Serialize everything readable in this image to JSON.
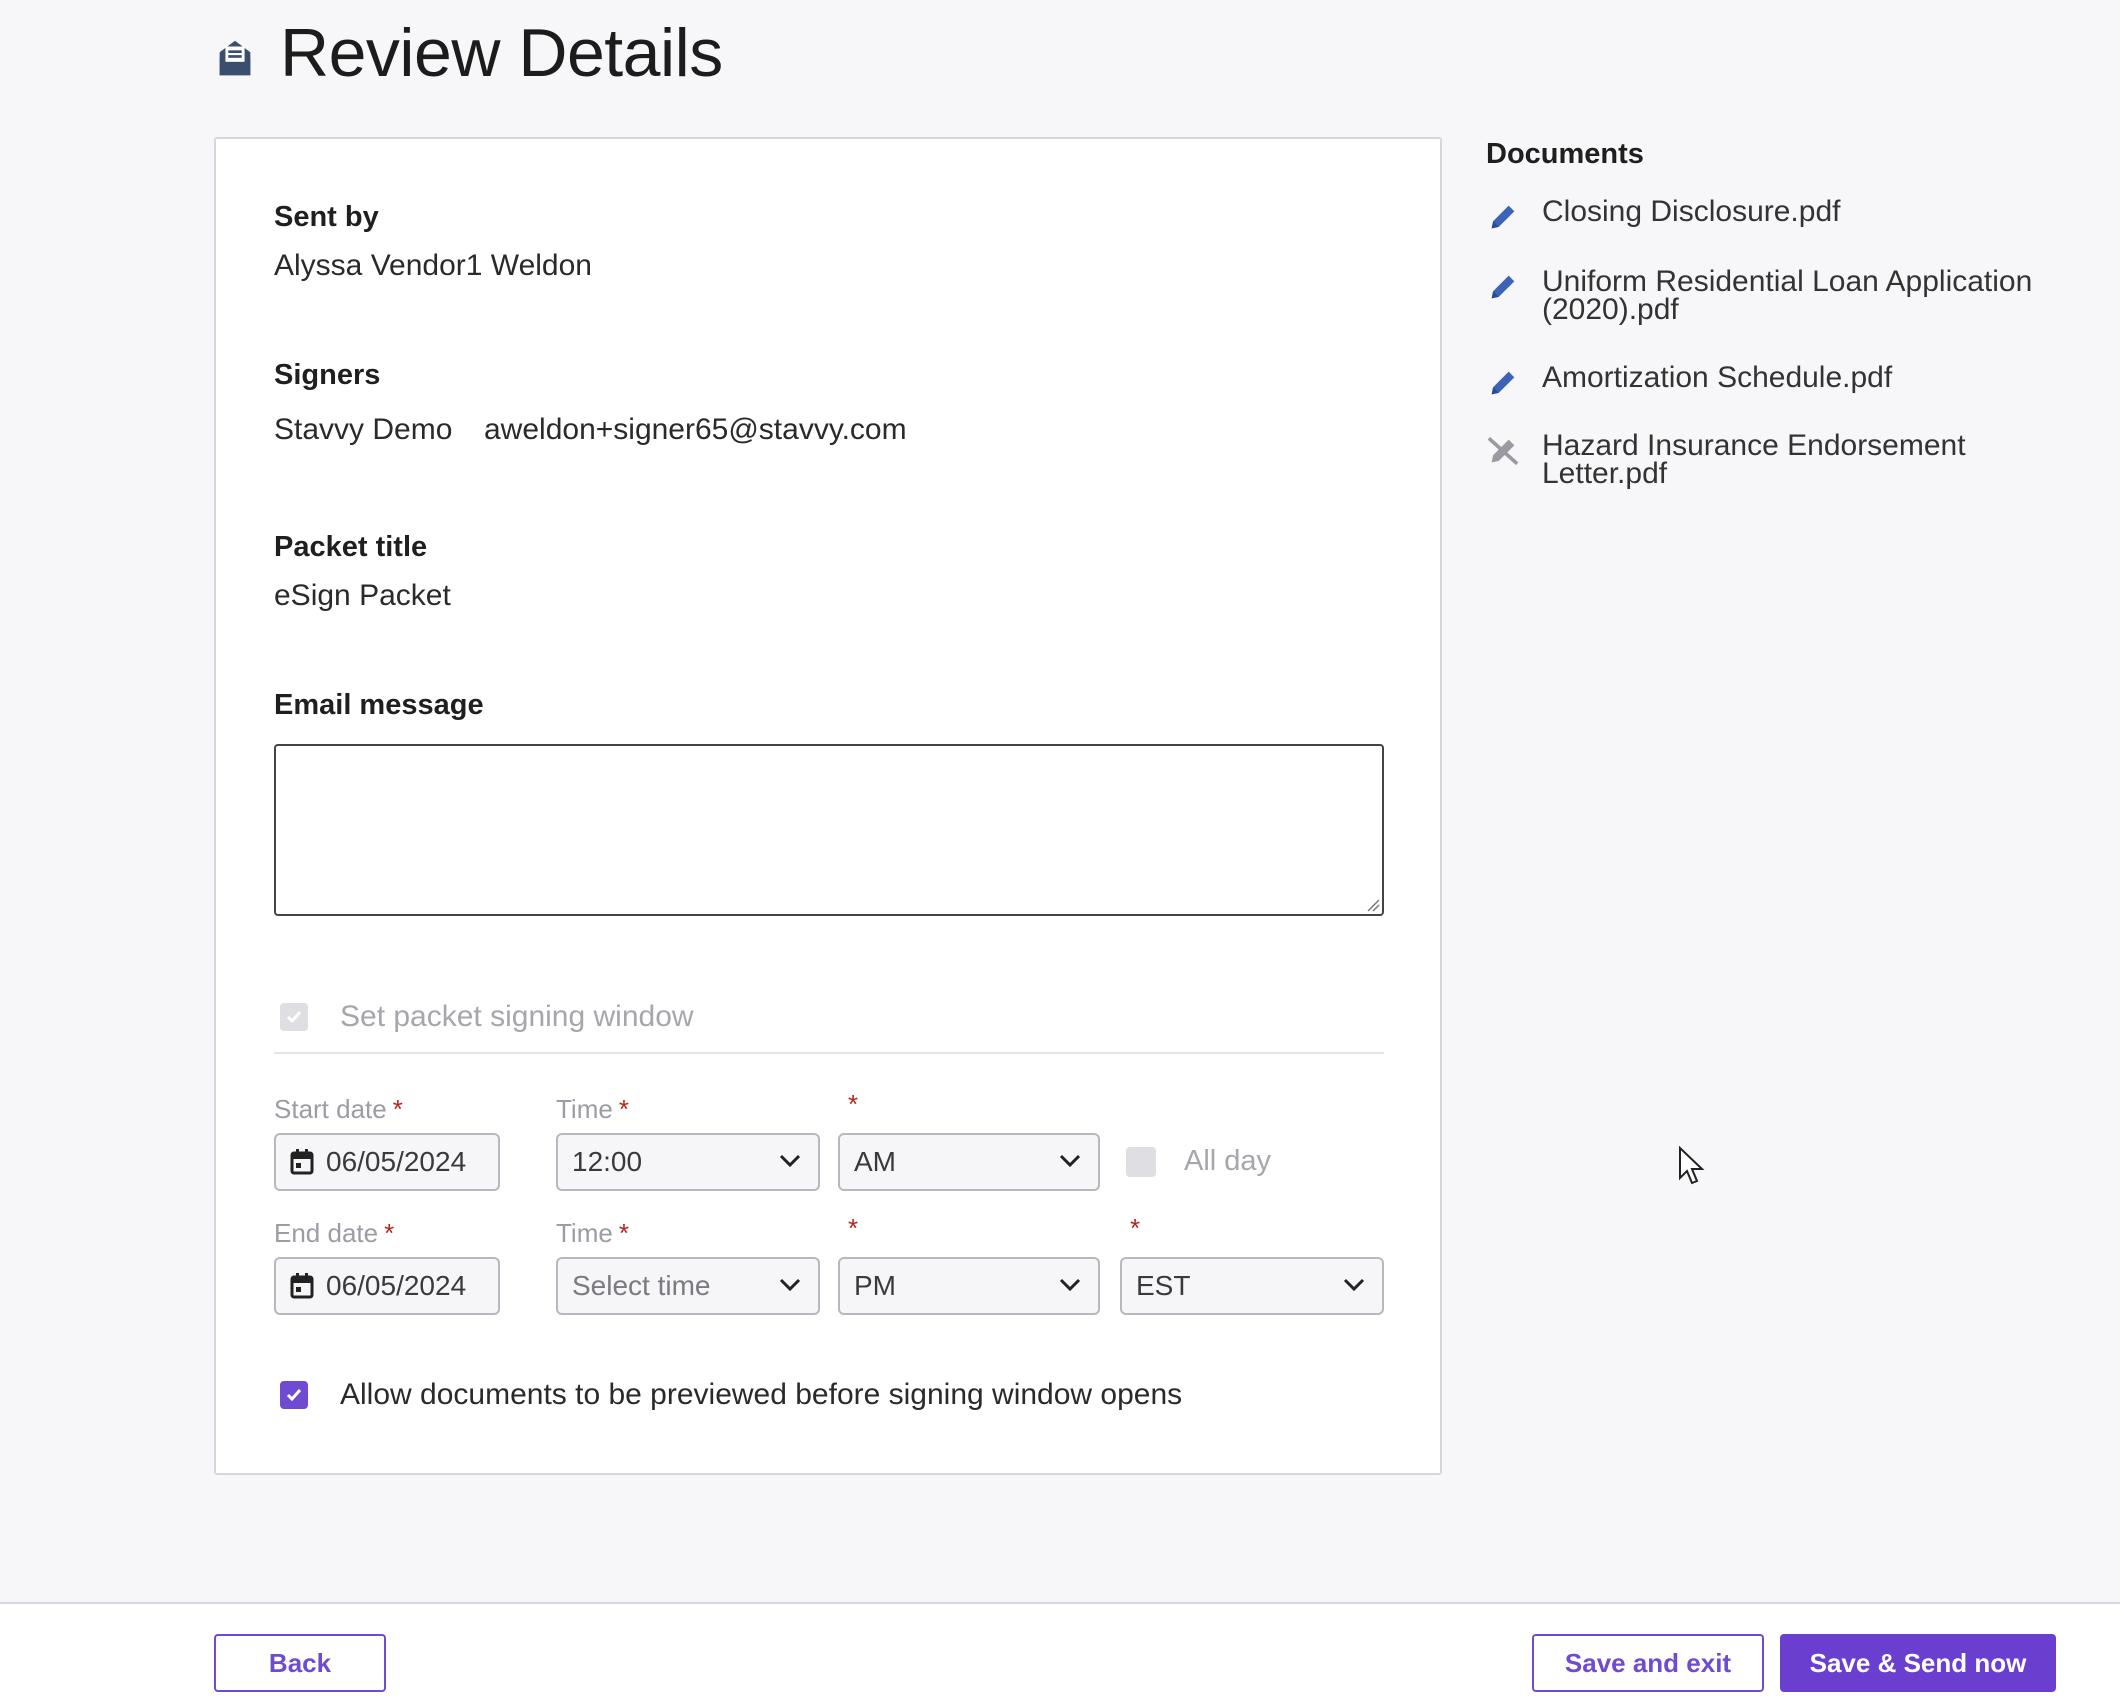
{
  "header": {
    "title": "Review Details",
    "icon": "envelope-icon"
  },
  "details": {
    "sent_by_label": "Sent by",
    "sent_by_value": "Alyssa Vendor1 Weldon",
    "signers_label": "Signers",
    "signer_name": "Stavvy Demo",
    "signer_email": "aweldon+signer65@stavvy.com",
    "packet_title_label": "Packet title",
    "packet_title_value": "eSign Packet",
    "email_message_label": "Email message",
    "email_message_value": ""
  },
  "signing_window": {
    "toggle_label": "Set packet signing window",
    "toggle_checked": true,
    "toggle_disabled": true,
    "start_date_label": "Start date",
    "start_date_value": "06/05/2024",
    "start_time_label": "Time",
    "start_time_value": "12:00",
    "start_ampm_value": "AM",
    "all_day_label": "All day",
    "end_date_label": "End date",
    "end_date_value": "06/05/2024",
    "end_time_label": "Time",
    "end_time_placeholder": "Select time",
    "end_ampm_value": "PM",
    "timezone_value": "EST",
    "required_mark": "*"
  },
  "preview": {
    "label": "Allow documents to be previewed before signing window opens",
    "checked": true
  },
  "documents": {
    "title": "Documents",
    "items": [
      {
        "name": "Closing Disclosure.pdf",
        "icon": "pencil-icon"
      },
      {
        "name": "Uniform Residential Loan Application (2020).pdf",
        "icon": "pencil-icon"
      },
      {
        "name": "Amortization Schedule.pdf",
        "icon": "pencil-icon"
      },
      {
        "name": "Hazard Insurance Endorsement Letter.pdf",
        "icon": "pencil-off-icon"
      }
    ]
  },
  "footer": {
    "back_label": "Back",
    "save_exit_label": "Save and exit",
    "save_send_label": "Save & Send now"
  },
  "colors": {
    "accent": "#6a3fd0",
    "required": "#b3261e",
    "doc_icon": "#3d63b8"
  }
}
